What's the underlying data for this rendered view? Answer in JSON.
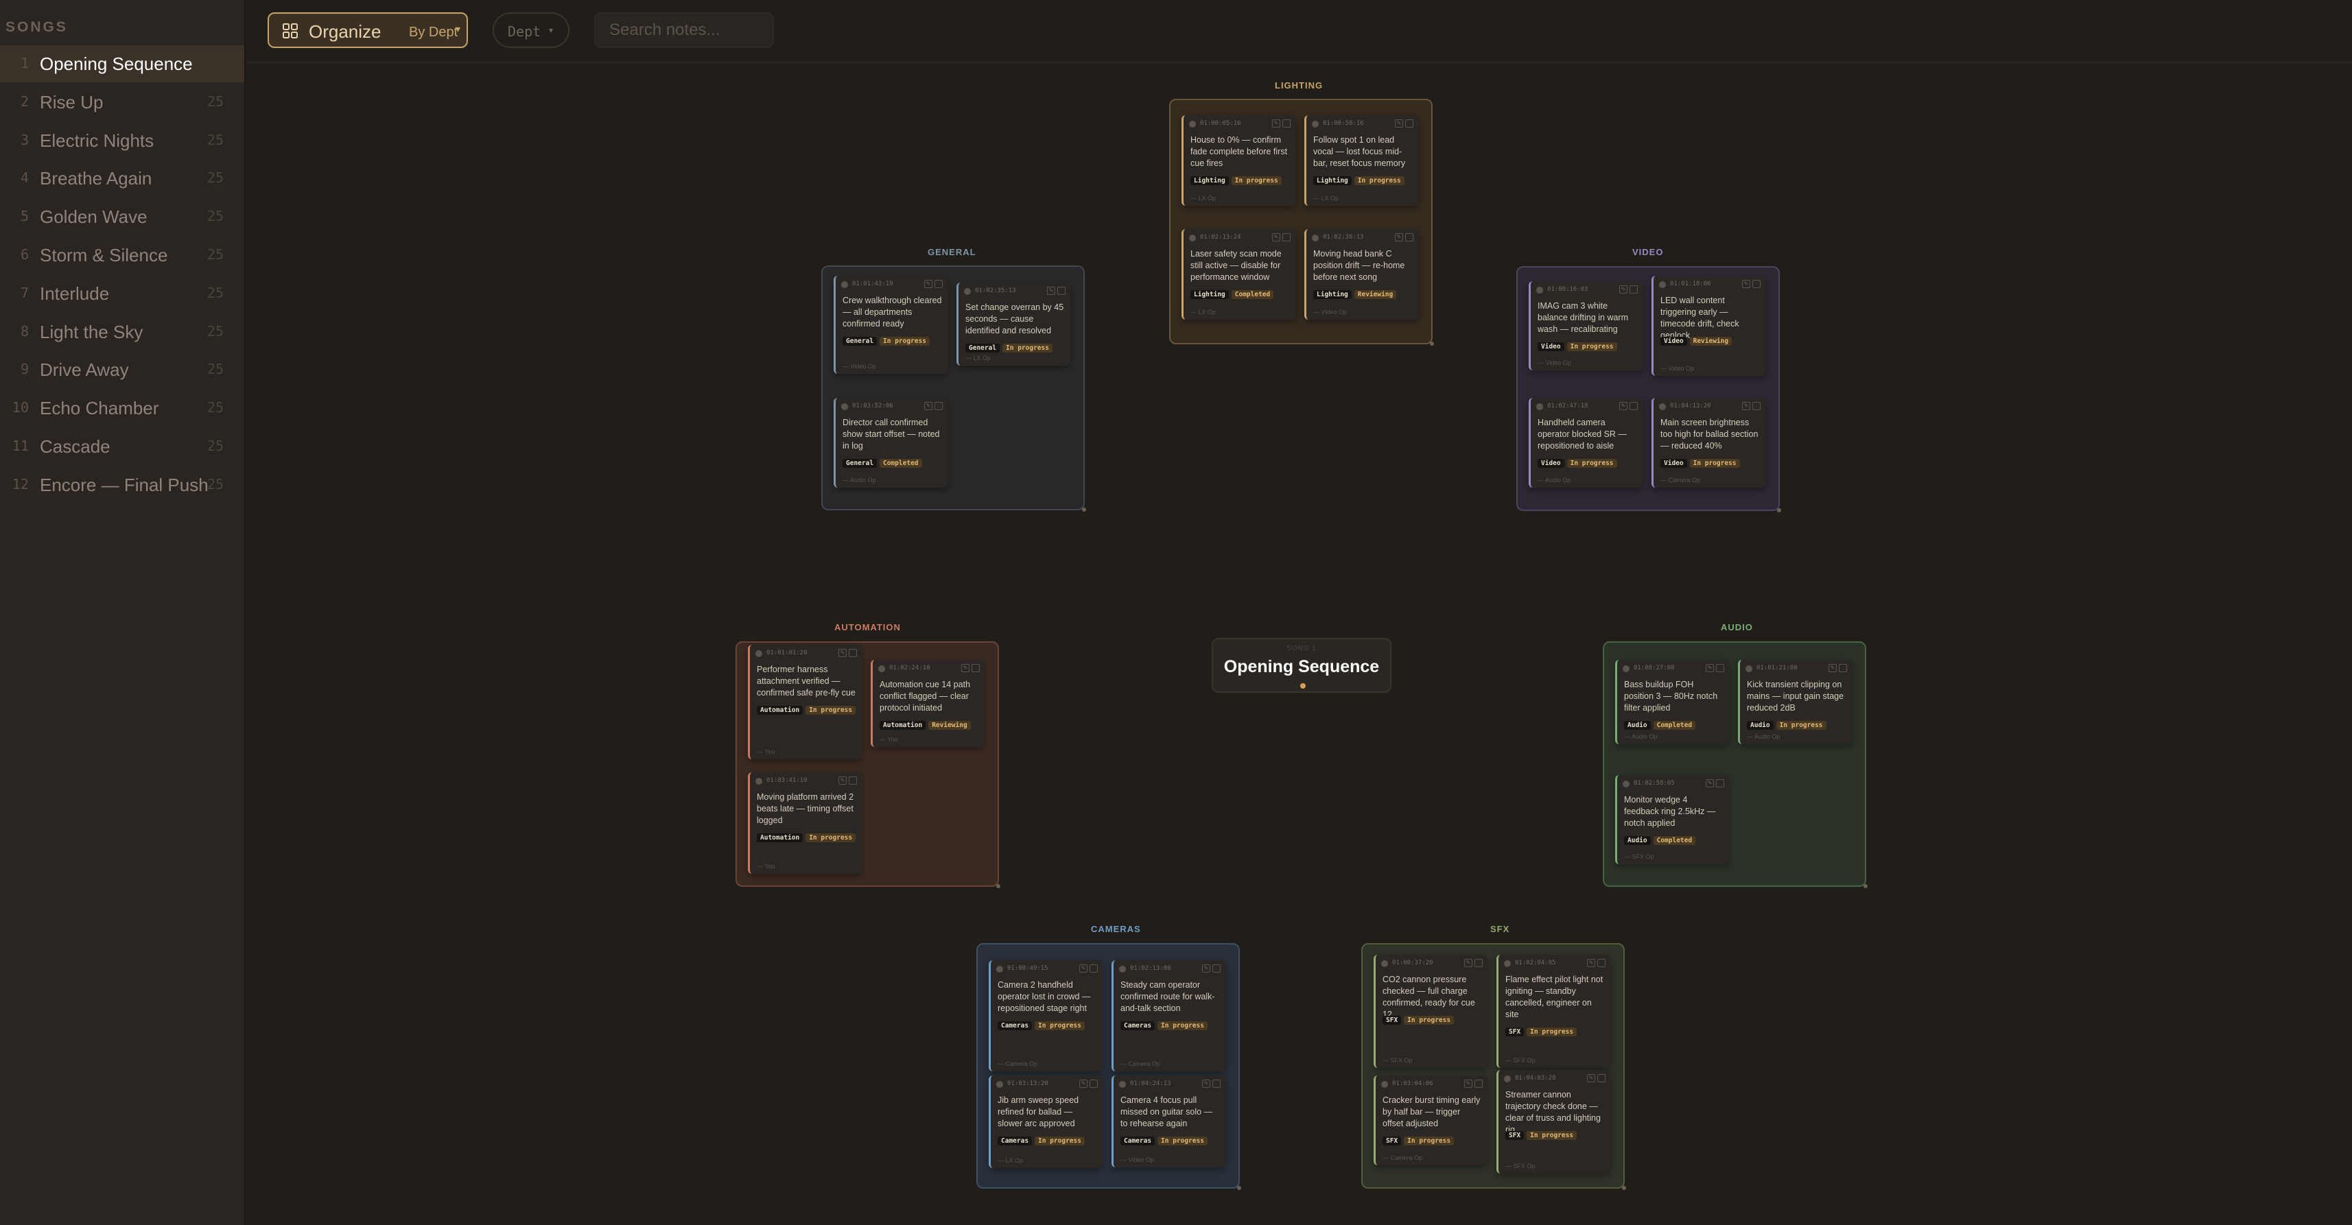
{
  "sidebar": {
    "header": "SONGS",
    "songs": [
      {
        "num": "1",
        "name": "Opening Sequence",
        "count": "",
        "selected": true
      },
      {
        "num": "2",
        "name": "Rise Up",
        "count": "25"
      },
      {
        "num": "3",
        "name": "Electric Nights",
        "count": "25"
      },
      {
        "num": "4",
        "name": "Breathe Again",
        "count": "25"
      },
      {
        "num": "5",
        "name": "Golden Wave",
        "count": "25"
      },
      {
        "num": "6",
        "name": "Storm & Silence",
        "count": "25"
      },
      {
        "num": "7",
        "name": "Interlude",
        "count": "25"
      },
      {
        "num": "8",
        "name": "Light the Sky",
        "count": "25"
      },
      {
        "num": "9",
        "name": "Drive Away",
        "count": "25"
      },
      {
        "num": "10",
        "name": "Echo Chamber",
        "count": "25"
      },
      {
        "num": "11",
        "name": "Cascade",
        "count": "25"
      },
      {
        "num": "12",
        "name": "Encore — Final Push",
        "count": "25"
      }
    ]
  },
  "toolbar": {
    "organize_label": "Organize",
    "organize_value": "By Dept",
    "dept_label": "Dept",
    "search_placeholder": "Search notes..."
  },
  "center": {
    "title": "Opening Sequence",
    "caption": "SONG 1"
  },
  "colors": {
    "accent": "#c8a36a",
    "lighting": "#c8a36a",
    "general": "#7e94a8",
    "video": "#9a87c6",
    "automation": "#c97a62",
    "audio": "#79ad77",
    "cameras": "#6f9ec6",
    "sfx": "#95ab72"
  },
  "groups": [
    {
      "id": "lighting",
      "label": "LIGHTING",
      "cards": [
        {
          "time": "01:00:05:16",
          "text": "House to 0% — confirm fade complete before first cue fires",
          "dept": "Lighting",
          "status": "In progress",
          "footer": "— LX Op"
        },
        {
          "time": "01:00:58:16",
          "text": "Follow spot 1 on lead vocal — lost focus mid-bar, reset focus memory",
          "dept": "Lighting",
          "status": "In progress",
          "footer": "— LX Op"
        },
        {
          "time": "01:02:13:24",
          "text": "Laser safety scan mode still active — disable for performance window",
          "dept": "Lighting",
          "status": "Completed",
          "footer": "— LX Op"
        },
        {
          "time": "01:02:38:13",
          "text": "Moving head bank C position drift — re-home before next song",
          "dept": "Lighting",
          "status": "Reviewing",
          "footer": "— Video Op"
        }
      ]
    },
    {
      "id": "general",
      "label": "GENERAL",
      "cards": [
        {
          "time": "01:01:43:19",
          "text": "Crew walkthrough cleared — all departments confirmed ready",
          "dept": "General",
          "status": "In progress",
          "footer": "— Video Op"
        },
        {
          "time": "01:02:35:13",
          "text": "Set change overran by 45 seconds — cause identified and resolved",
          "dept": "General",
          "status": "In progress",
          "footer": "— LX Op"
        },
        {
          "time": "01:03:52:06",
          "text": "Director call confirmed show start offset — noted in log",
          "dept": "General",
          "status": "Completed",
          "footer": "— Audio Op"
        }
      ]
    },
    {
      "id": "video",
      "label": "VIDEO",
      "cards": [
        {
          "time": "01:00:16:03",
          "text": "IMAG cam 3 white balance drifting in warm wash — recalibrating",
          "dept": "Video",
          "status": "In progress",
          "footer": "— Video Op"
        },
        {
          "time": "01:01:18:06",
          "text": "LED wall content triggering early — timecode drift, check genlock",
          "dept": "Video",
          "status": "Reviewing",
          "footer": "— Video Op"
        },
        {
          "time": "01:02:47:18",
          "text": "Handheld camera operator blocked SR — repositioned to aisle",
          "dept": "Video",
          "status": "In progress",
          "footer": "— Audio Op"
        },
        {
          "time": "01:04:13:20",
          "text": "Main screen brightness too high for ballad section — reduced 40%",
          "dept": "Video",
          "status": "In progress",
          "footer": "— Camera Op"
        }
      ]
    },
    {
      "id": "automation",
      "label": "AUTOMATION",
      "cards": [
        {
          "time": "01:01:01:20",
          "text": "Performer harness attachment verified — confirmed safe pre-fly cue",
          "dept": "Automation",
          "status": "In progress",
          "footer": "— You"
        },
        {
          "time": "01:02:24:10",
          "text": "Automation cue 14 path conflict flagged — clear protocol initiated",
          "dept": "Automation",
          "status": "Reviewing",
          "footer": "— You"
        },
        {
          "time": "01:03:41:10",
          "text": "Moving platform arrived 2 beats late — timing offset logged",
          "dept": "Automation",
          "status": "In progress",
          "footer": "— You"
        }
      ]
    },
    {
      "id": "audio",
      "label": "AUDIO",
      "cards": [
        {
          "time": "01:00:27:08",
          "text": "Bass buildup FOH position 3 — 80Hz notch filter applied",
          "dept": "Audio",
          "status": "Completed",
          "footer": "— Audio Op"
        },
        {
          "time": "01:01:21:00",
          "text": "Kick transient clipping on mains — input gain stage reduced 2dB",
          "dept": "Audio",
          "status": "In progress",
          "footer": "— Audio Op"
        },
        {
          "time": "01:02:58:05",
          "text": "Monitor wedge 4 feedback ring 2.5kHz — notch applied",
          "dept": "Audio",
          "status": "Completed",
          "footer": "— SFX Op"
        }
      ]
    },
    {
      "id": "cameras",
      "label": "CAMERAS",
      "cards": [
        {
          "time": "01:00:49:15",
          "text": "Camera 2 handheld operator lost in crowd — repositioned stage right",
          "dept": "Cameras",
          "status": "In progress",
          "footer": "— Camera Op"
        },
        {
          "time": "01:02:13:08",
          "text": "Steady cam operator confirmed route for walk-and-talk section",
          "dept": "Cameras",
          "status": "In progress",
          "footer": "— Camera Op"
        },
        {
          "time": "01:03:13:20",
          "text": "Jib arm sweep speed refined for ballad — slower arc approved",
          "dept": "Cameras",
          "status": "In progress",
          "footer": "— LX Op"
        },
        {
          "time": "01:04:24:13",
          "text": "Camera 4 focus pull missed on guitar solo — to rehearse again",
          "dept": "Cameras",
          "status": "In progress",
          "footer": "— Video Op"
        }
      ]
    },
    {
      "id": "sfx",
      "label": "SFX",
      "cards": [
        {
          "time": "01:00:37:20",
          "text": "CO2 cannon pressure checked — full charge confirmed, ready for cue 12",
          "dept": "SFX",
          "status": "In progress",
          "footer": "— SFX Op"
        },
        {
          "time": "01:02:04:05",
          "text": "Flame effect pilot light not igniting — standby cancelled, engineer on site",
          "dept": "SFX",
          "status": "In progress",
          "footer": "— SFX Op"
        },
        {
          "time": "01:03:04:06",
          "text": "Cracker burst timing early by half bar — trigger offset adjusted",
          "dept": "SFX",
          "status": "In progress",
          "footer": "— Camera Op"
        },
        {
          "time": "01:04:03:20",
          "text": "Streamer cannon trajectory check done — clear of truss and lighting rig",
          "dept": "SFX",
          "status": "In progress",
          "footer": "— SFX Op"
        }
      ]
    }
  ]
}
